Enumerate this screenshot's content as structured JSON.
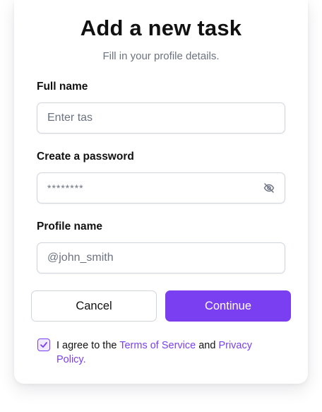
{
  "header": {
    "title": "Add a new task",
    "subtitle": "Fill in your profile details."
  },
  "fields": {
    "full_name": {
      "label": "Full name",
      "value": "",
      "placeholder": "Enter tas"
    },
    "password": {
      "label": "Create a password",
      "value": "********",
      "visibility_icon": "eye-off-icon"
    },
    "profile_name": {
      "label": "Profile name",
      "value": "",
      "placeholder": "@john_smith"
    }
  },
  "actions": {
    "cancel_label": "Cancel",
    "continue_label": "Continue"
  },
  "agreement": {
    "checked": true,
    "prefix": "I agree to the ",
    "terms_link": "Terms of Service",
    "middle": " and ",
    "privacy_link": "Privacy Policy."
  },
  "colors": {
    "accent": "#7b3ff2",
    "border": "#d0d5dd",
    "muted_text": "#6b7280"
  }
}
